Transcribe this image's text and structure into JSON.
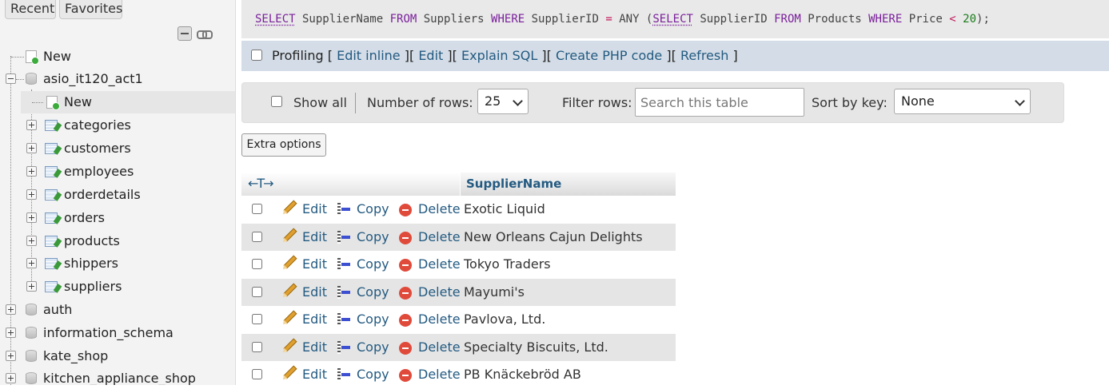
{
  "sidebar": {
    "tabs": {
      "recent": "Recent",
      "favorites": "Favorites"
    },
    "new_root": "New",
    "database": "asio_it120_act1",
    "db_new": "New",
    "tables": [
      "categories",
      "customers",
      "employees",
      "orderdetails",
      "orders",
      "products",
      "shippers",
      "suppliers"
    ],
    "other_dbs": [
      "auth",
      "information_schema",
      "kate_shop",
      "kitchen_appliance_shop"
    ]
  },
  "sql": {
    "t1": "SELECT",
    "t2": " SupplierName ",
    "t3": "FROM",
    "t4": " Suppliers ",
    "t5": "WHERE",
    "t6": " SupplierID ",
    "t7": "=",
    "t8": " ANY (",
    "t9": "SELECT",
    "t10": " SupplierID ",
    "t11": "FROM",
    "t12": " Products ",
    "t13": "WHERE",
    "t14": " Price ",
    "t15": "<",
    "t16": " ",
    "t17": "20",
    "t18": ");"
  },
  "profiling": {
    "label": "Profiling",
    "links": {
      "edit_inline": "Edit inline",
      "edit": "Edit",
      "explain": "Explain SQL",
      "php": "Create PHP code",
      "refresh": "Refresh"
    },
    "open": "[",
    "close": "]"
  },
  "controls": {
    "show_all": "Show all",
    "rows_label": "Number of rows:",
    "rows_value": "25",
    "filter_label": "Filter rows:",
    "filter_placeholder": "Search this table",
    "sort_label": "Sort by key:",
    "sort_value": "None"
  },
  "extra_options": "Extra options",
  "results": {
    "column": "SupplierName",
    "arrows": "←T→",
    "actions": {
      "edit": "Edit",
      "copy": "Copy",
      "delete": "Delete"
    },
    "rows": [
      "Exotic Liquid",
      "New Orleans Cajun Delights",
      "Tokyo Traders",
      "Mayumi's",
      "Pavlova, Ltd.",
      "Specialty Biscuits, Ltd.",
      "PB Knäckebröd AB"
    ]
  }
}
